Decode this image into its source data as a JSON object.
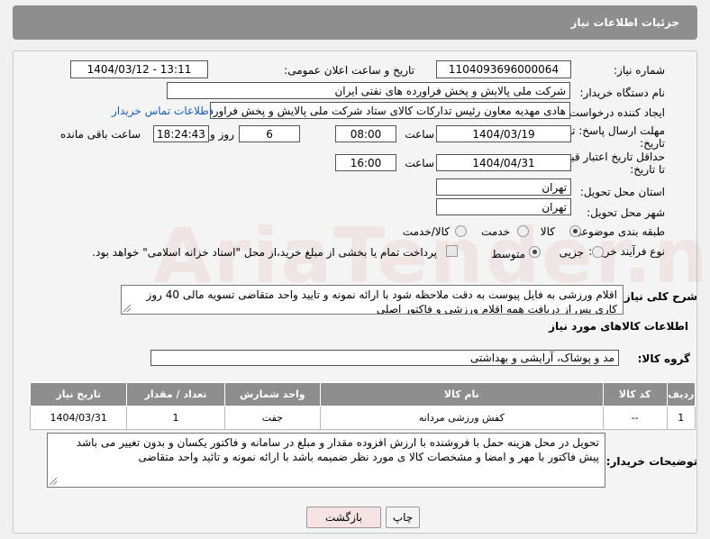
{
  "header": {
    "title": "جزئیات اطلاعات نیاز"
  },
  "fields": {
    "need_number_label": "شماره نیاز:",
    "need_number": "1104093696000064",
    "announce_label": "تاریخ و ساعت اعلان عمومی:",
    "announce_value": "1404/03/12 - 13:11",
    "buyer_org_label": "نام دستگاه خریدار:",
    "buyer_org": "شرکت ملی پالایش و پخش فراورده های نفتی ایران",
    "creator_label": "ایجاد کننده درخواست:",
    "creator": "هادی مهدیه معاون رئیس تدارکات کالای ستاد شرکت ملی پالایش و پخش فراورده های نفتی ایران",
    "contact_link": "اطلاعات تماس خریدار",
    "reply_deadline_label_1": "مهلت ارسال پاسخ: تا",
    "reply_deadline_label_2": "تاریخ:",
    "reply_date": "1404/03/19",
    "time_label": "ساعت",
    "reply_time": "08:00",
    "days_value": "6",
    "days_label": "روز و",
    "remaining_time": "18:24:43",
    "remaining_label": "ساعت باقی مانده",
    "price_deadline_label_1": "حداقل تاریخ اعتبار قیمت:",
    "price_deadline_label_2": "تا تاریخ:",
    "price_date": "1404/04/31",
    "price_time": "16:00",
    "province_label": "استان محل تحویل:",
    "province": "تهران",
    "city_label": "شهر محل تحویل:",
    "city": "تهران",
    "category_label": "طبقه بندی موضوعی:",
    "category_options": [
      "کالا",
      "خدمت",
      "کالا/خدمت"
    ],
    "process_label": "نوع فرآیند خرید :",
    "process_options": [
      "جزیی",
      "متوسط"
    ],
    "payment_note": "پرداخت تمام یا بخشی از مبلغ خرید،از محل \"اسناد خزانه اسلامی\" خواهد بود."
  },
  "description": {
    "label": "شرح کلی نیاز:",
    "text": "اقلام ورزشی به  فایل پیوست به دقت ملاحظه شود با ارائه نمونه و تایید واحد متقاضی  تسویه مالی 40 روز کاری پس از دریافت همه اقلام ورزشی و فاکتور اصلی"
  },
  "goods": {
    "section_title": "اطلاعات کالاهای مورد نیاز",
    "group_label": "گروه کالا:",
    "group_value": "مد و پوشاک، آرایشی و بهداشتی",
    "columns": [
      "ردیف",
      "کد کالا",
      "نام کالا",
      "واحد شمارش",
      "تعداد / مقدار",
      "تاریخ نیاز"
    ],
    "rows": [
      [
        "1",
        "--",
        "کفش ورزشی مردانه",
        "جفت",
        "1",
        "1404/03/31"
      ]
    ]
  },
  "buyer_notes": {
    "label": "توضیحات خریدار:",
    "text": "تحویل در محل هزینه حمل با فروشنده با ارزش افزوده مقدار و مبلغ در سامانه و فاکتور یکسان و بدون تغییر می باشد پیش فاکتور با مهر و امضا و مشخصات کالا ی مورد نظر ضمیمه باشد با ارائه نمونه و تائید واحد متقاضی"
  },
  "buttons": {
    "print": "چاپ",
    "back": "بازگشت"
  },
  "colors": {
    "header_bg": "#8e8e8e",
    "link": "#1a5fb4",
    "back_btn_bg": "#f7e3e3"
  }
}
